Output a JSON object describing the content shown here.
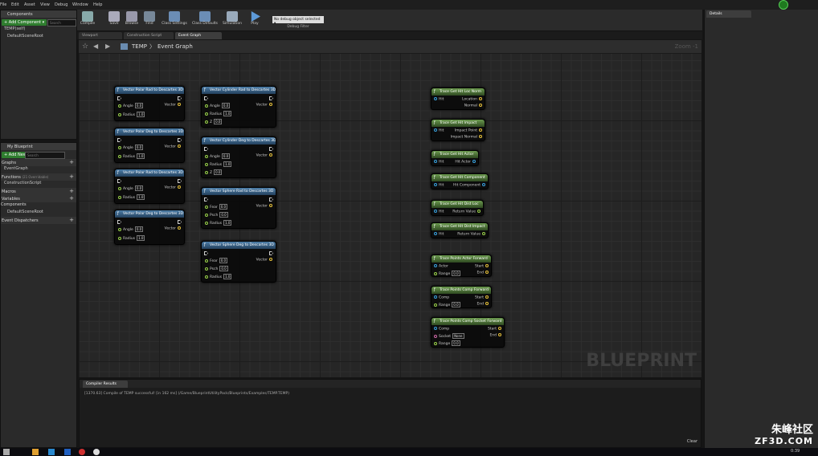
{
  "menu": {
    "items": [
      "File",
      "Edit",
      "Asset",
      "View",
      "Debug",
      "Window",
      "Help"
    ]
  },
  "components": {
    "tab": "Components",
    "add_label": "+ Add Component ▾",
    "search_placeholder": "Search",
    "items": [
      "TEMP(self)",
      "DefaultSceneRoot"
    ]
  },
  "mybp": {
    "tab": "My Blueprint",
    "add_label": "+ Add New ▾",
    "search_placeholder": "Search",
    "rows": [
      {
        "label": "Graphs",
        "type": "cat"
      },
      {
        "label": "EventGraph",
        "type": "item"
      },
      {
        "label": "Functions",
        "extra": "(21 Overridable)",
        "type": "cat"
      },
      {
        "label": "ConstructionScript",
        "type": "item"
      },
      {
        "label": "Macros",
        "type": "cat"
      },
      {
        "label": "Variables",
        "type": "cat"
      },
      {
        "label": "Components",
        "type": "sub"
      },
      {
        "label": "DefaultSceneRoot",
        "type": "item"
      },
      {
        "label": "Event Dispatchers",
        "type": "cat"
      }
    ]
  },
  "toolbar": {
    "buttons": [
      "Compile",
      "Save",
      "Browse",
      "Find",
      "Class Settings",
      "Class Defaults",
      "Simulation",
      "Play"
    ],
    "debug_select": "No debug object selected ▾",
    "debug_filter": "Debug Filter"
  },
  "tabs": [
    "Viewport",
    "Construction Script",
    "Event Graph"
  ],
  "breadcrumb": {
    "root": "TEMP",
    "sep": "〉",
    "current": "Event Graph",
    "zoom": "Zoom -1"
  },
  "nodes": {
    "n1": {
      "title": "Vector Polar Rad to Descartes 3D",
      "angle": "Angle",
      "angle_v": "0.0",
      "radius": "Radius",
      "radius_v": "1.0",
      "out": "Vector"
    },
    "n2": {
      "title": "Vector Polar Deg to Descartes 3D",
      "angle": "Angle",
      "angle_v": "0.0",
      "radius": "Radius",
      "radius_v": "1.0",
      "out": "Vector"
    },
    "n3": {
      "title": "Vector Polar Rad to Descartes 3D",
      "angle": "Angle",
      "angle_v": "0.0",
      "radius": "Radius",
      "radius_v": "1.0",
      "out": "Vector"
    },
    "n4": {
      "title": "Vector Polar Deg to Descartes 3D",
      "angle": "Angle",
      "angle_v": "0.0",
      "radius": "Radius",
      "radius_v": "1.0",
      "out": "Vector"
    },
    "n5": {
      "title": "Vector Cylinder Rad to Descartes 3D",
      "angle": "Angle",
      "angle_v": "0.0",
      "radius": "Radius",
      "radius_v": "1.0",
      "z": "Z",
      "z_v": "0.0",
      "out": "Vector"
    },
    "n6": {
      "title": "Vector Cylinder Deg to Descartes 3D",
      "angle": "Angle",
      "angle_v": "0.0",
      "radius": "Radius",
      "radius_v": "1.0",
      "z": "Z",
      "z_v": "0.0",
      "out": "Vector"
    },
    "n7": {
      "title": "Vector Sphere Rad to Descartes 3D",
      "fear": "Fear",
      "fear_v": "0.0",
      "psch": "Psch",
      "psch_v": "0.0",
      "radius": "Radius",
      "radius_v": "1.0",
      "out": "Vector"
    },
    "n8": {
      "title": "Vector Sphere Deg to Descartes 3D",
      "fear": "Fear",
      "fear_v": "0.0",
      "psch": "Psch",
      "psch_v": "0.0",
      "radius": "Radius",
      "radius_v": "1.0",
      "out": "Vector"
    },
    "t1": {
      "title": "Trace Get Hit Loc Norm",
      "in": "Hit",
      "o1": "Location",
      "o2": "Normal"
    },
    "t2": {
      "title": "Trace Get Hit Impact",
      "in": "Hit",
      "o1": "Impact Point",
      "o2": "Impact Normal"
    },
    "t3": {
      "title": "Trace Get Hit Actor",
      "in": "Hit",
      "o1": "Hit Actor"
    },
    "t4": {
      "title": "Trace Get Hit Component",
      "in": "Hit",
      "o1": "Hit Component"
    },
    "t5": {
      "title": "Trace Get Hit Dist Loc",
      "in": "Hit",
      "o1": "Return Value"
    },
    "t6": {
      "title": "Trace Get Hit Dist Impact",
      "in": "Hit",
      "o1": "Return Value"
    },
    "t7": {
      "title": "Trace Points Actor Forward",
      "i1": "Actor",
      "i2": "Range",
      "i2_v": "0.0",
      "o1": "Start",
      "o2": "End"
    },
    "t8": {
      "title": "Trace Points Comp Forward",
      "i1": "Comp",
      "i2": "Range",
      "i2_v": "0.0",
      "o1": "Start",
      "o2": "End"
    },
    "t9": {
      "title": "Trace Points Comp Socket Forward",
      "i1": "Comp",
      "i2": "Socket",
      "i2_v": "None",
      "i3": "Range",
      "i3_v": "0.0",
      "o1": "Start",
      "o2": "End"
    }
  },
  "watermark": "BLUEPRINT",
  "compiler": {
    "tab": "Compiler Results",
    "line": "[1370.63] Compile of TEMP successful! [in 162 ms] (/Game/BlueprintUtilityPack/Blueprints/Examples/TEMP.TEMP)",
    "clear": "Clear"
  },
  "details": {
    "tab": "Details"
  },
  "overlay": {
    "brand": "朱峰社区",
    "site": "ZF3D.COM"
  },
  "clock": "0:39"
}
